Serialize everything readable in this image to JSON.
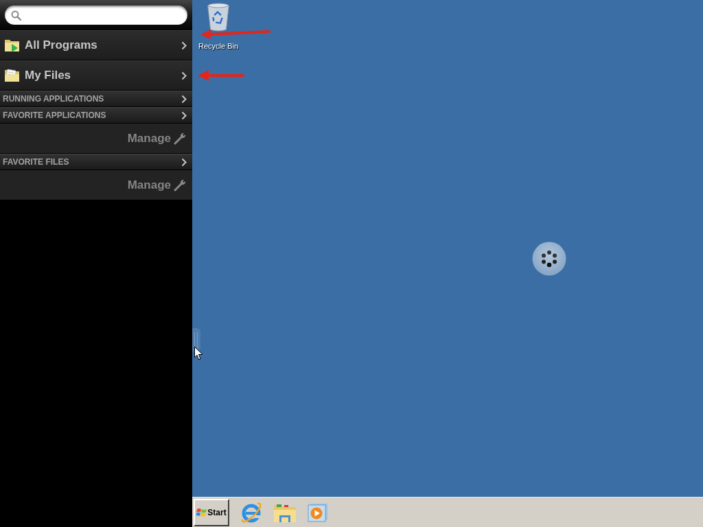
{
  "start_menu": {
    "items": [
      {
        "label": "All Programs"
      },
      {
        "label": "My Files"
      }
    ],
    "sections": [
      {
        "title": "RUNNING APPLICATIONS"
      },
      {
        "title": "FAVORITE APPLICATIONS",
        "action": "Manage"
      },
      {
        "title": "FAVORITE FILES",
        "action": "Manage"
      }
    ]
  },
  "desktop": {
    "icons": [
      {
        "label": "Recycle Bin"
      }
    ]
  },
  "taskbar": {
    "start_button": "Start"
  }
}
